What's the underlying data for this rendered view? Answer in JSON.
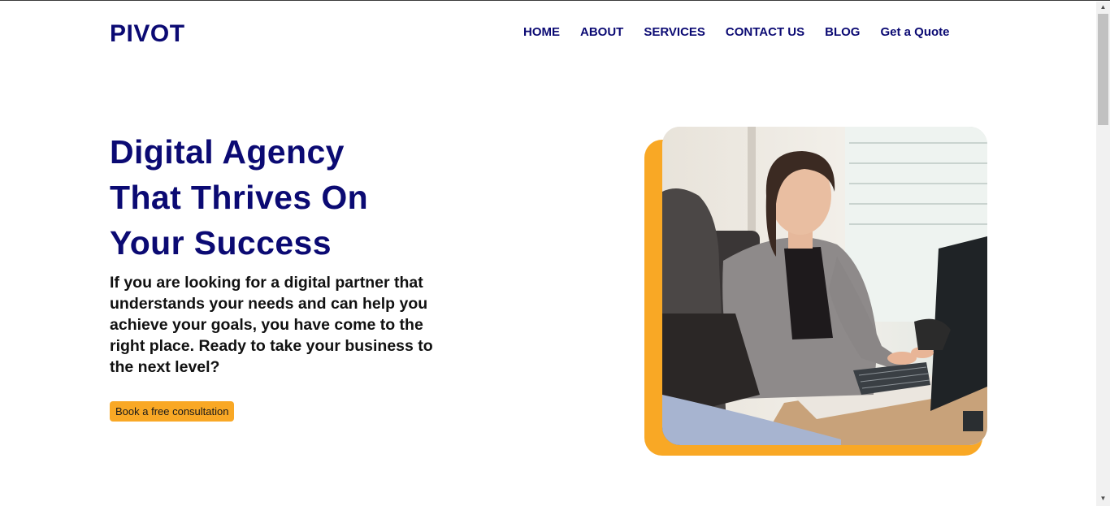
{
  "brand": {
    "logo": "PIVOT"
  },
  "nav": {
    "items": [
      {
        "label": "HOME"
      },
      {
        "label": "ABOUT"
      },
      {
        "label": "SERVICES"
      },
      {
        "label": "CONTACT US"
      },
      {
        "label": "BLOG"
      },
      {
        "label": "Get a Quote"
      }
    ]
  },
  "hero": {
    "title_lines": [
      "Digital Agency",
      "That Thrives On",
      "Your Success"
    ],
    "description": "If you are looking for a digital partner that understands your needs and can help you achieve your goals, you have come to the right place. Ready to take your business to the next level?",
    "cta_label": "Book a free consultation"
  },
  "colors": {
    "brand_navy": "#0b0a73",
    "accent_orange": "#f9a825",
    "text_dark": "#111111"
  },
  "icons": {
    "scroll_up": "▲",
    "scroll_down": "▼"
  }
}
